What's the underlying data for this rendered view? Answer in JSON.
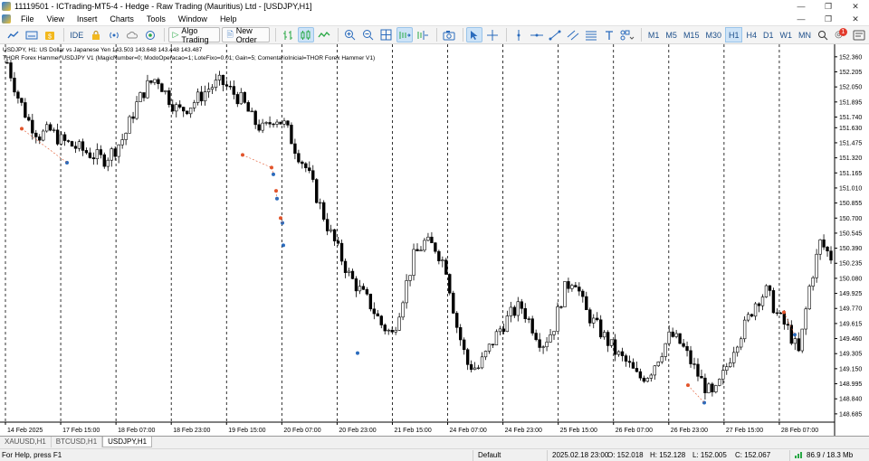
{
  "window": {
    "title": "11119501 - ICTrading-MT5-4 - Hedge - Raw Trading (Mauritius) Ltd - [USDJPY,H1]",
    "buttons": [
      "—",
      "❐",
      "✕"
    ]
  },
  "menu": {
    "items": [
      "File",
      "View",
      "Insert",
      "Charts",
      "Tools",
      "Window",
      "Help"
    ],
    "right_buttons": [
      "—",
      "❐",
      "✕"
    ]
  },
  "toolbar": {
    "ide_label": "IDE",
    "algo_label": "Algo Trading",
    "new_order_label": "New Order",
    "timeframes": [
      "M1",
      "M5",
      "M15",
      "M30",
      "H1",
      "H4",
      "D1",
      "W1",
      "MN"
    ],
    "active_timeframe": "H1",
    "notification_count": "1"
  },
  "chart_info": {
    "line1": "USDJPY, H1:  US Dollar vs Japanese Yen  143.503 143.648 143.448 143.487",
    "line2": "THOR Forex Hammer USDJPY V1 (MagicNumber=0; ModoOperacao=1; LoteFixo=0.01; Gain=5; ComentarioInicial=THOR Forex Hammer V1)"
  },
  "chart_data": {
    "type": "candlestick",
    "symbol": "USDJPY",
    "timeframe": "H1",
    "price_axis_labels": [
      "152.360",
      "152.205",
      "152.050",
      "151.895",
      "151.740",
      "151.630",
      "151.475",
      "151.320",
      "151.165",
      "151.010",
      "150.855",
      "150.700",
      "150.545",
      "150.390",
      "150.235",
      "150.080",
      "149.925",
      "149.770",
      "149.615",
      "149.460",
      "149.305",
      "149.150",
      "148.995",
      "148.840",
      "148.685"
    ],
    "price_range": [
      148.6,
      152.47
    ],
    "time_axis_labels": [
      "14 Feb 2025",
      "17 Feb 15:00",
      "18 Feb 07:00",
      "18 Feb 23:00",
      "19 Feb 15:00",
      "20 Feb 07:00",
      "20 Feb 23:00",
      "21 Feb 15:00",
      "24 Feb 07:00",
      "24 Feb 23:00",
      "25 Feb 15:00",
      "26 Feb 07:00",
      "26 Feb 23:00",
      "27 Feb 15:00",
      "28 Feb 07:00"
    ],
    "period_separators": true,
    "candle_colors": {
      "bull": "#000000",
      "bear": "#000000",
      "bull_fill": "#ffffff",
      "bear_fill": "#000000"
    },
    "close_path": [
      152.3,
      151.95,
      151.7,
      151.55,
      151.6,
      151.5,
      151.45,
      151.4,
      151.35,
      151.3,
      151.4,
      151.55,
      151.85,
      152.05,
      152.15,
      151.95,
      151.8,
      151.85,
      151.95,
      152.05,
      152.1,
      152.0,
      151.9,
      151.7,
      151.6,
      151.75,
      151.65,
      151.4,
      151.2,
      150.9,
      150.6,
      150.35,
      150.1,
      149.95,
      149.8,
      149.6,
      149.5,
      149.9,
      150.3,
      150.45,
      150.4,
      150.2,
      149.6,
      149.2,
      149.15,
      149.35,
      149.55,
      149.7,
      149.8,
      149.6,
      149.4,
      149.55,
      149.95,
      150.1,
      149.75,
      149.6,
      149.45,
      149.3,
      149.2,
      149.05,
      149.1,
      149.3,
      149.5,
      149.4,
      149.2,
      149.0,
      148.85,
      149.1,
      149.4,
      149.6,
      149.85,
      149.95,
      149.7,
      149.55,
      149.3,
      150.0,
      150.45,
      150.3
    ],
    "signal_markers": [
      {
        "price": 151.62,
        "type": "sell"
      },
      {
        "price": 151.27,
        "type": "buy"
      },
      {
        "price": 151.35,
        "type": "sell"
      },
      {
        "price": 151.22,
        "type": "sell"
      },
      {
        "price": 151.15,
        "type": "buy"
      },
      {
        "price": 150.98,
        "type": "sell"
      },
      {
        "price": 150.9,
        "type": "buy"
      },
      {
        "price": 150.7,
        "type": "sell"
      },
      {
        "price": 150.65,
        "type": "buy"
      },
      {
        "price": 150.42,
        "type": "buy"
      },
      {
        "price": 149.31,
        "type": "buy"
      },
      {
        "price": 148.98,
        "type": "sell"
      },
      {
        "price": 148.8,
        "type": "buy"
      },
      {
        "price": 149.73,
        "type": "sell"
      },
      {
        "price": 149.5,
        "type": "buy"
      }
    ]
  },
  "symbol_tabs": [
    "XAUUSD,H1",
    "BTCUSD,H1",
    "USDJPY,H1"
  ],
  "active_tab": "USDJPY,H1",
  "status": {
    "help": "For Help, press F1",
    "profile": "Default",
    "datetime": "2025.02.18 23:00",
    "open": "O: 152.018",
    "high": "H: 152.128",
    "low": "L: 152.005",
    "close": "C: 152.067",
    "traffic": "86.9 / 18.3 Mb"
  }
}
